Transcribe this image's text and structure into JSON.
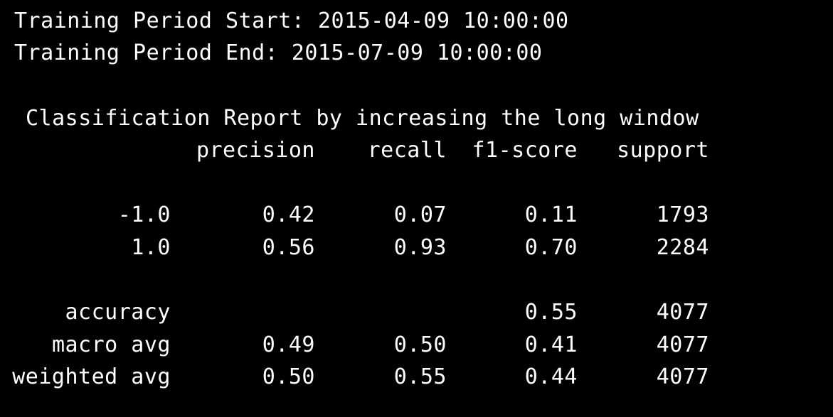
{
  "training": {
    "start_line": "Training Period Start: 2015-04-09 10:00:00",
    "end_line": "Training Period End: 2015-07-09 10:00:00"
  },
  "report": {
    "title": "Classification Report by increasing the long window",
    "headers": {
      "precision": "precision",
      "recall": "recall",
      "f1": "f1-score",
      "support": "support"
    },
    "rows": [
      {
        "label": "-1.0",
        "precision": "0.42",
        "recall": "0.07",
        "f1": "0.11",
        "support": "1793"
      },
      {
        "label": "1.0",
        "precision": "0.56",
        "recall": "0.93",
        "f1": "0.70",
        "support": "2284"
      },
      {
        "label": "accuracy",
        "precision": "",
        "recall": "",
        "f1": "0.55",
        "support": "4077"
      },
      {
        "label": "macro avg",
        "precision": "0.49",
        "recall": "0.50",
        "f1": "0.41",
        "support": "4077"
      },
      {
        "label": "weighted avg",
        "precision": "0.50",
        "recall": "0.55",
        "f1": "0.44",
        "support": "4077"
      }
    ]
  }
}
